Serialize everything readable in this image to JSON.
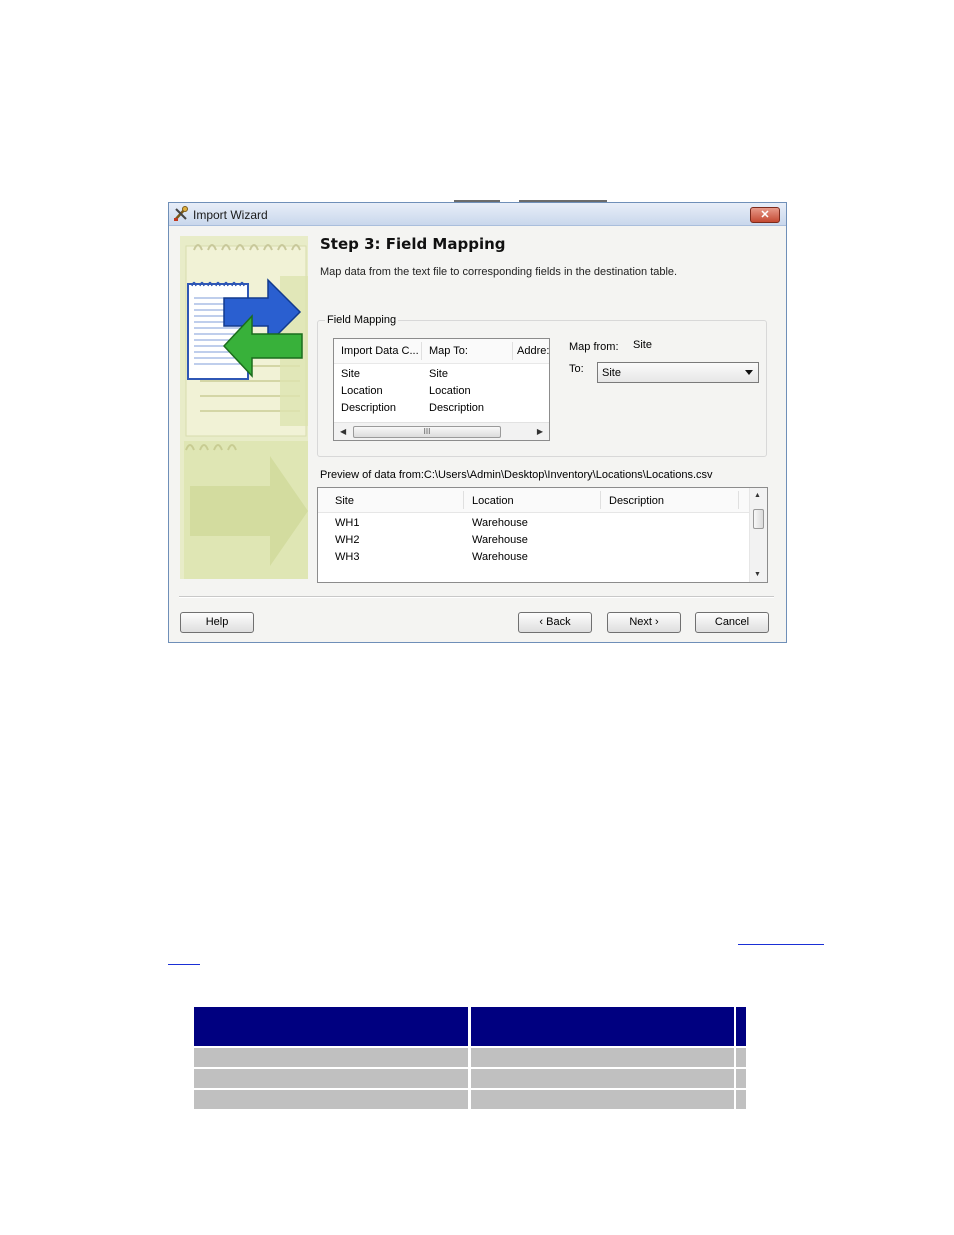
{
  "window": {
    "title": "Import Wizard",
    "close_glyph": "✕"
  },
  "step": {
    "title": "Step 3: Field Mapping",
    "description": "Map data from the text file to corresponding fields in the destination table."
  },
  "field_mapping": {
    "group_label": "Field Mapping",
    "columns": [
      "Import Data C...",
      "Map To:",
      "Addre:"
    ],
    "rows": [
      {
        "import": "Site",
        "map_to": "Site"
      },
      {
        "import": "Location",
        "map_to": "Location"
      },
      {
        "import": "Description",
        "map_to": "Description"
      }
    ],
    "scroll_thumb_glyph": "III",
    "map_from_label": "Map from:",
    "map_from_value": "Site",
    "to_label": "To:",
    "to_value": "Site"
  },
  "preview": {
    "label": "Preview of data from:C:\\Users\\Admin\\Desktop\\Inventory\\Locations\\Locations.csv",
    "columns": [
      "Site",
      "Location",
      "Description"
    ],
    "rows": [
      {
        "site": "WH1",
        "location": "Warehouse",
        "description": ""
      },
      {
        "site": "WH2",
        "location": "Warehouse",
        "description": ""
      },
      {
        "site": "WH3",
        "location": "Warehouse",
        "description": ""
      }
    ]
  },
  "buttons": {
    "help": "Help",
    "back": "‹ Back",
    "next": "Next ›",
    "cancel": "Cancel"
  },
  "colors": {
    "table_header": "#000080",
    "table_row": "#c0c0c0",
    "link": "#1a2fd6"
  }
}
